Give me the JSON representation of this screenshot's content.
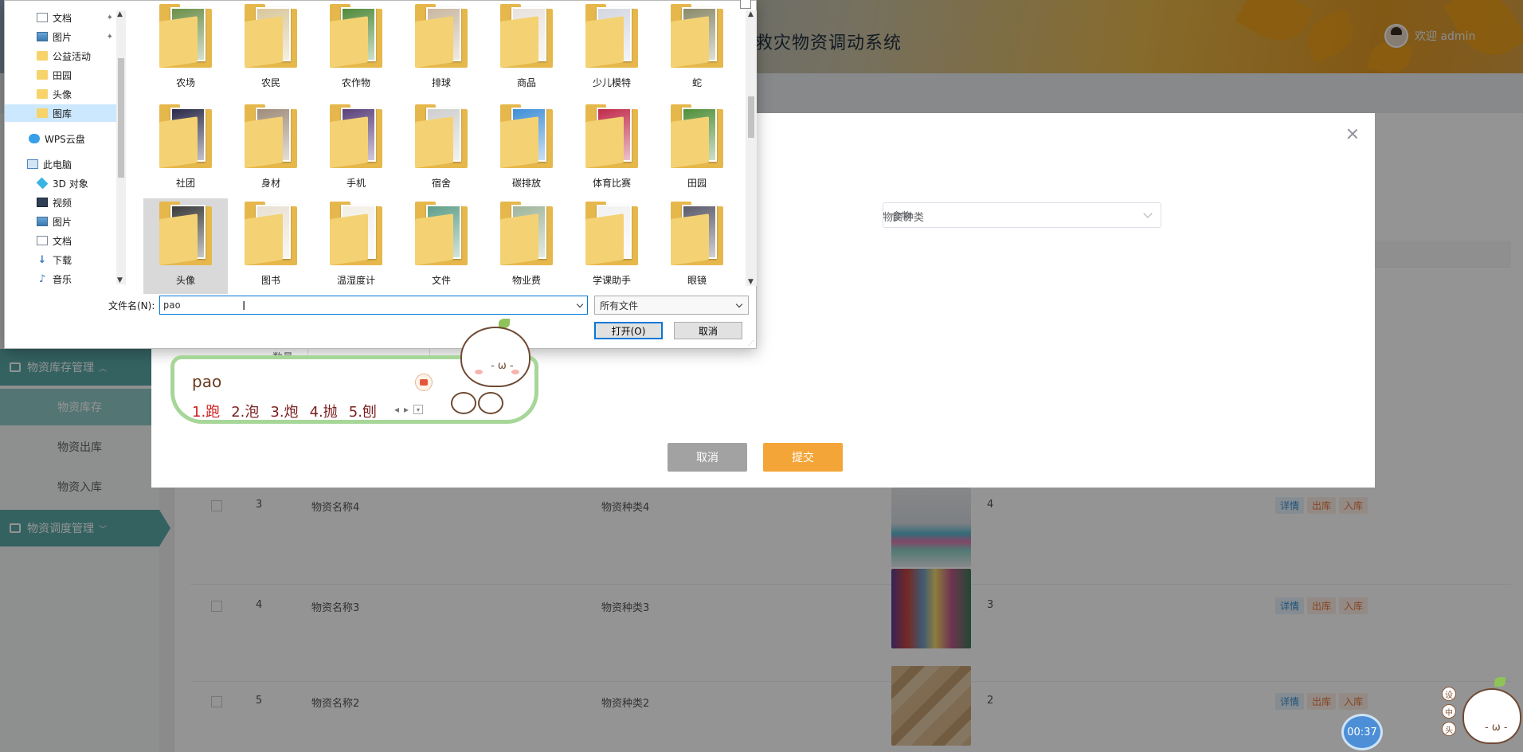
{
  "app": {
    "title": "救灾物资调动系统",
    "user": "欢迎 admin"
  },
  "sidebar": {
    "groups": [
      {
        "label": "物资库存管理",
        "items": [
          "物资库存",
          "物资出库",
          "物资入库"
        ]
      },
      {
        "label": "物资调度管理"
      }
    ]
  },
  "table": {
    "rows": [
      {
        "index": "3",
        "name": "物资名称4",
        "category": "物资种类4",
        "qty": "4"
      },
      {
        "index": "4",
        "name": "物资名称3",
        "category": "物资种类3",
        "qty": "3"
      },
      {
        "index": "5",
        "name": "物资名称2",
        "category": "物资种类2",
        "qty": "2"
      }
    ],
    "actions": {
      "detail": "详情",
      "out": "出库",
      "in": "入库"
    }
  },
  "modal": {
    "category_label": "物资种类",
    "category_value": "食物",
    "qty_label": "数量",
    "cancel_label": "取消",
    "submit_label": "提交"
  },
  "file_dialog": {
    "nav_items": [
      {
        "label": "文档",
        "icon": "document-icon",
        "pinned": true
      },
      {
        "label": "图片",
        "icon": "pictures-icon",
        "pinned": true
      },
      {
        "label": "公益活动",
        "icon": "folder-icon"
      },
      {
        "label": "田园",
        "icon": "folder-icon"
      },
      {
        "label": "头像",
        "icon": "folder-icon"
      },
      {
        "label": "图库",
        "icon": "folder-icon",
        "selected": true
      },
      {
        "label": "WPS云盘",
        "icon": "cloud-icon"
      },
      {
        "label": "此电脑",
        "icon": "computer-icon"
      },
      {
        "label": "3D 对象",
        "icon": "3d-objects-icon"
      },
      {
        "label": "视频",
        "icon": "video-icon"
      },
      {
        "label": "图片",
        "icon": "pictures-icon"
      },
      {
        "label": "文档",
        "icon": "document-icon"
      },
      {
        "label": "下载",
        "icon": "download-icon"
      },
      {
        "label": "音乐",
        "icon": "music-icon"
      }
    ],
    "folders": [
      [
        "农场",
        "农民",
        "农作物",
        "排球",
        "商品",
        "少儿模特",
        "蛇"
      ],
      [
        "社团",
        "身材",
        "手机",
        "宿舍",
        "碳排放",
        "体育比赛",
        "田园"
      ],
      [
        "头像",
        "图书",
        "温湿度计",
        "文件",
        "物业费",
        "学课助手",
        "眼镜"
      ]
    ],
    "filename_label": "文件名(N):",
    "filename_value": "pao",
    "filetype_value": "所有文件",
    "open_label": "打开(O)",
    "cancel_label": "取消",
    "colors": {
      "accent": "#0078d7",
      "selected_nav": "#cce8ff"
    }
  },
  "ime": {
    "input": "pao",
    "candidates": [
      "1.跑",
      "2.泡",
      "3.炮",
      "4.抛",
      "5.刨"
    ]
  },
  "widgets": {
    "timer": "00:37",
    "tools": [
      "设",
      "中",
      "头"
    ]
  }
}
